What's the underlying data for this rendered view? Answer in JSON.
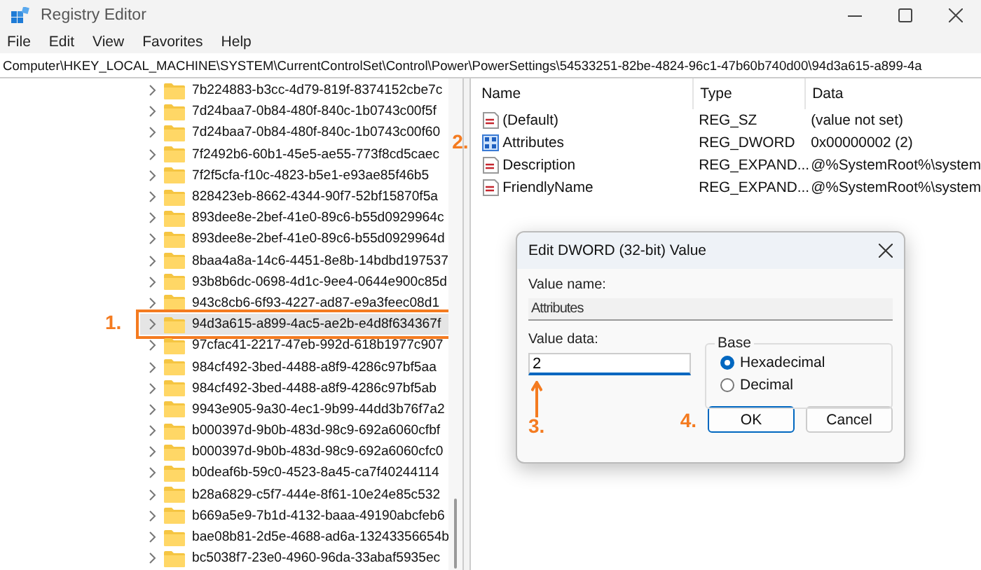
{
  "window": {
    "title": "Registry Editor"
  },
  "menu": [
    "File",
    "Edit",
    "View",
    "Favorites",
    "Help"
  ],
  "address_bar": {
    "path": "Computer\\HKEY_LOCAL_MACHINE\\SYSTEM\\CurrentControlSet\\Control\\Power\\PowerSettings\\54533251-82be-4824-96c1-47b60b740d00\\94d3a615-a899-4a"
  },
  "tree": {
    "items": [
      {
        "label": "7b224883-b3cc-4d79-819f-8374152cbe7c",
        "selected": false
      },
      {
        "label": "7d24baa7-0b84-480f-840c-1b0743c00f5f",
        "selected": false
      },
      {
        "label": "7d24baa7-0b84-480f-840c-1b0743c00f60",
        "selected": false
      },
      {
        "label": "7f2492b6-60b1-45e5-ae55-773f8cd5caec",
        "selected": false
      },
      {
        "label": "7f2f5cfa-f10c-4823-b5e1-e93ae85f46b5",
        "selected": false
      },
      {
        "label": "828423eb-8662-4344-90f7-52bf15870f5a",
        "selected": false
      },
      {
        "label": "893dee8e-2bef-41e0-89c6-b55d0929964c",
        "selected": false
      },
      {
        "label": "893dee8e-2bef-41e0-89c6-b55d0929964d",
        "selected": false
      },
      {
        "label": "8baa4a8a-14c6-4451-8e8b-14bdbd197537",
        "selected": false
      },
      {
        "label": "93b8b6dc-0698-4d1c-9ee4-0644e900c85d",
        "selected": false
      },
      {
        "label": "943c8cb6-6f93-4227-ad87-e9a3feec08d1",
        "selected": false
      },
      {
        "label": "94d3a615-a899-4ac5-ae2b-e4d8f634367f",
        "selected": true
      },
      {
        "label": "97cfac41-2217-47eb-992d-618b1977c907",
        "selected": false
      },
      {
        "label": "984cf492-3bed-4488-a8f9-4286c97bf5aa",
        "selected": false
      },
      {
        "label": "984cf492-3bed-4488-a8f9-4286c97bf5ab",
        "selected": false
      },
      {
        "label": "9943e905-9a30-4ec1-9b99-44dd3b76f7a2",
        "selected": false
      },
      {
        "label": "b000397d-9b0b-483d-98c9-692a6060cfbf",
        "selected": false
      },
      {
        "label": "b000397d-9b0b-483d-98c9-692a6060cfc0",
        "selected": false
      },
      {
        "label": "b0deaf6b-59c0-4523-8a45-ca7f40244114",
        "selected": false
      },
      {
        "label": "b28a6829-c5f7-444e-8f61-10e24e85c532",
        "selected": false
      },
      {
        "label": "b669a5e9-7b1d-4132-baaa-49190abcfeb6",
        "selected": false
      },
      {
        "label": "bae08b81-2d5e-4688-ad6a-13243356654b",
        "selected": false
      },
      {
        "label": "bc5038f7-23e0-4960-96da-33abaf5935ec",
        "selected": false
      }
    ]
  },
  "values": {
    "columns": [
      "Name",
      "Type",
      "Data"
    ],
    "rows": [
      {
        "kind": "string",
        "name": "(Default)",
        "type": "REG_SZ",
        "data": "(value not set)"
      },
      {
        "kind": "binary",
        "name": "Attributes",
        "type": "REG_DWORD",
        "data": "0x00000002 (2)"
      },
      {
        "kind": "string",
        "name": "Description",
        "type": "REG_EXPAND...",
        "data": "@%SystemRoot%\\system"
      },
      {
        "kind": "string",
        "name": "FriendlyName",
        "type": "REG_EXPAND...",
        "data": "@%SystemRoot%\\system"
      }
    ]
  },
  "dialog": {
    "title": "Edit DWORD (32-bit) Value",
    "value_name_label": "Value name:",
    "value_name": "Attributes",
    "value_data_label": "Value data:",
    "value_data": "2",
    "base_label": "Base",
    "options": [
      {
        "label": "Hexadecimal",
        "selected": true
      },
      {
        "label": "Decimal",
        "selected": false
      }
    ],
    "buttons": [
      "OK",
      "Cancel"
    ]
  },
  "annotations": {
    "tree_item": "1.",
    "value_row": "2.",
    "value_data": "3.",
    "ok_button": "4."
  }
}
